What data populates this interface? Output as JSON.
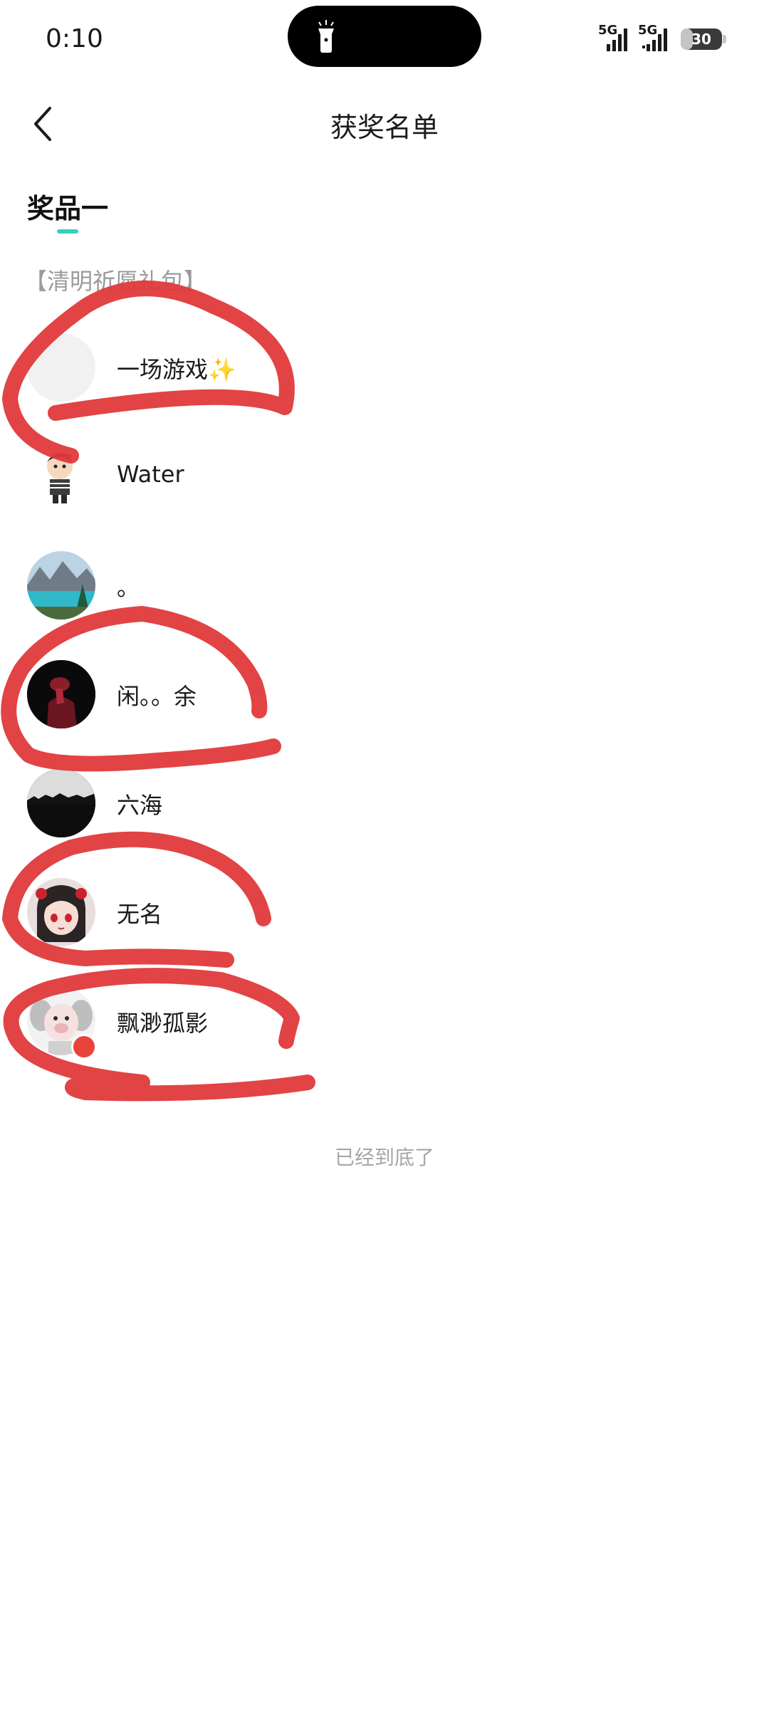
{
  "status_bar": {
    "time": "0:10",
    "signal_1_label": "5G",
    "signal_2_label": "5G",
    "battery": "30",
    "battery_level": 0.3
  },
  "nav": {
    "title": "获奖名单"
  },
  "tabs": [
    {
      "label": "奖品一",
      "selected": true
    }
  ],
  "prize": {
    "name": "【清明祈愿礼包】"
  },
  "winners": [
    {
      "name": "一场游戏✨",
      "avatar": "blank-avatar"
    },
    {
      "name": "Water",
      "avatar": "cartoon-boy-avatar"
    },
    {
      "name": "。",
      "avatar": "lake-mountain-avatar"
    },
    {
      "name": "闲。。余",
      "avatar": "dark-red-figure-avatar"
    },
    {
      "name": "六海",
      "avatar": "dark-skyline-avatar"
    },
    {
      "name": "无名",
      "avatar": "anime-girl-avatar"
    },
    {
      "name": "飘渺孤影",
      "avatar": "white-pig-avatar"
    }
  ],
  "footer": {
    "end_text": "已经到底了"
  },
  "colors": {
    "accent": "#35cfc0",
    "scribble": "#e0393a",
    "muted_text": "#9a9a9a"
  }
}
